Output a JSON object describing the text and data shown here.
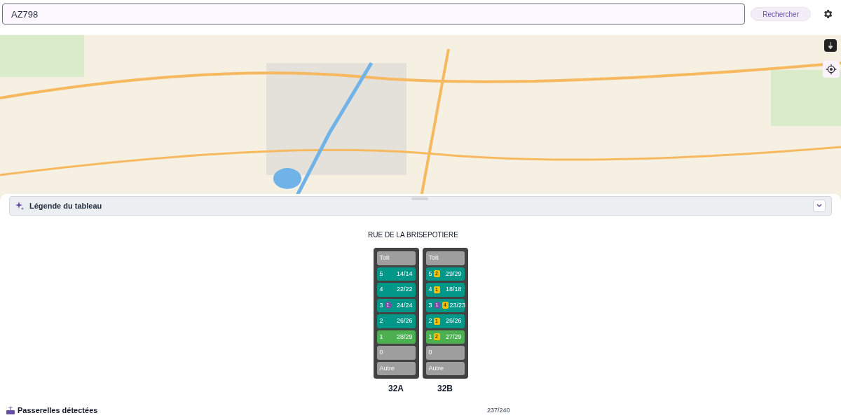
{
  "search": {
    "value": "AZ798",
    "button": "Rechercher"
  },
  "legend": {
    "title": "Légende du tableau",
    "expanded": false
  },
  "street": "RUE DE LA BRISEPOTIERE",
  "buildings": [
    {
      "name": "32A",
      "floors": [
        {
          "label": "Toit",
          "color": "#9e9e9e"
        },
        {
          "label": "5",
          "color": "#009688",
          "count": "14/14"
        },
        {
          "label": "4",
          "color": "#009688",
          "count": "22/22"
        },
        {
          "label": "3",
          "color": "#009688",
          "badges": [
            {
              "kind": "circle",
              "text": "1"
            }
          ],
          "count": "24/24"
        },
        {
          "label": "2",
          "color": "#009688",
          "count": "26/26"
        },
        {
          "label": "1",
          "color": "#4caf50",
          "count": "28/29"
        },
        {
          "label": "0",
          "color": "#9e9e9e"
        },
        {
          "label": "Autre",
          "color": "#9e9e9e"
        }
      ]
    },
    {
      "name": "32B",
      "floors": [
        {
          "label": "Toit",
          "color": "#9e9e9e"
        },
        {
          "label": "5",
          "color": "#009688",
          "badges": [
            {
              "kind": "square",
              "text": "2"
            }
          ],
          "count": "29/29"
        },
        {
          "label": "4",
          "color": "#009688",
          "badges": [
            {
              "kind": "square",
              "text": "1"
            }
          ],
          "count": "18/18"
        },
        {
          "label": "3",
          "color": "#009688",
          "badges": [
            {
              "kind": "circle",
              "text": "1"
            },
            {
              "kind": "square",
              "text": "4"
            }
          ],
          "count": "23/23"
        },
        {
          "label": "2",
          "color": "#009688",
          "badges": [
            {
              "kind": "square",
              "text": "1"
            }
          ],
          "count": "26/26"
        },
        {
          "label": "1",
          "color": "#4caf50",
          "badges": [
            {
              "kind": "square",
              "text": "2"
            }
          ],
          "count": "27/29"
        },
        {
          "label": "0",
          "color": "#9e9e9e"
        },
        {
          "label": "Autre",
          "color": "#9e9e9e"
        }
      ]
    }
  ],
  "gateways": {
    "title": "Passerelles détectées",
    "count": "237/240"
  }
}
